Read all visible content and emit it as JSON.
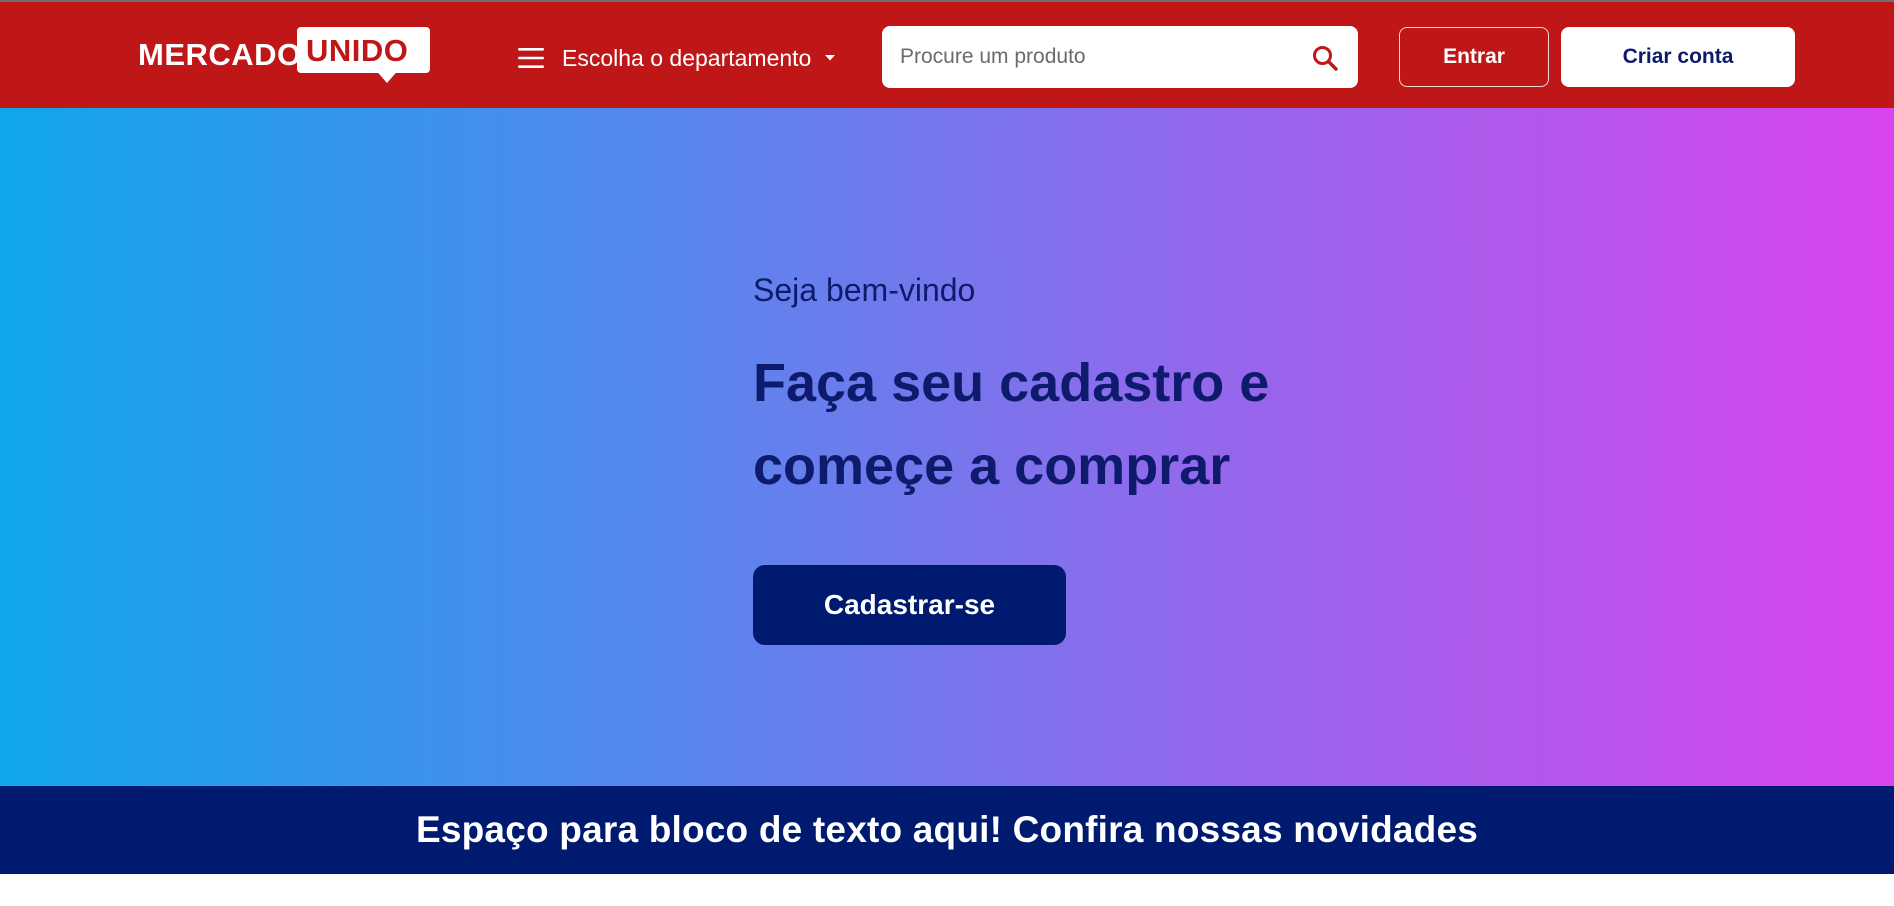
{
  "header": {
    "logo": {
      "left_text": "MERCADO",
      "right_text": "UNIDO"
    },
    "department": {
      "label": "Escolha o departamento",
      "menu_icon": "hamburger-menu-icon",
      "caret_icon": "caret-down-icon"
    },
    "search": {
      "placeholder": "Procure um produto",
      "value": "",
      "icon": "search-icon"
    },
    "login_label": "Entrar",
    "signup_label": "Criar conta"
  },
  "hero": {
    "welcome": "Seja bem-vindo",
    "title_line1": "Faça seu cadastro e",
    "title_line2": "começe a comprar",
    "cta_label": "Cadastrar-se"
  },
  "banner": {
    "text": "Espaço para bloco de texto aqui! Confira nossas novidades"
  },
  "colors": {
    "header_red": "#bf1618",
    "navy": "#001a70",
    "title_navy": "#0e1b6d",
    "gradient_start": "#10a6e9",
    "gradient_end": "#d944ee"
  }
}
